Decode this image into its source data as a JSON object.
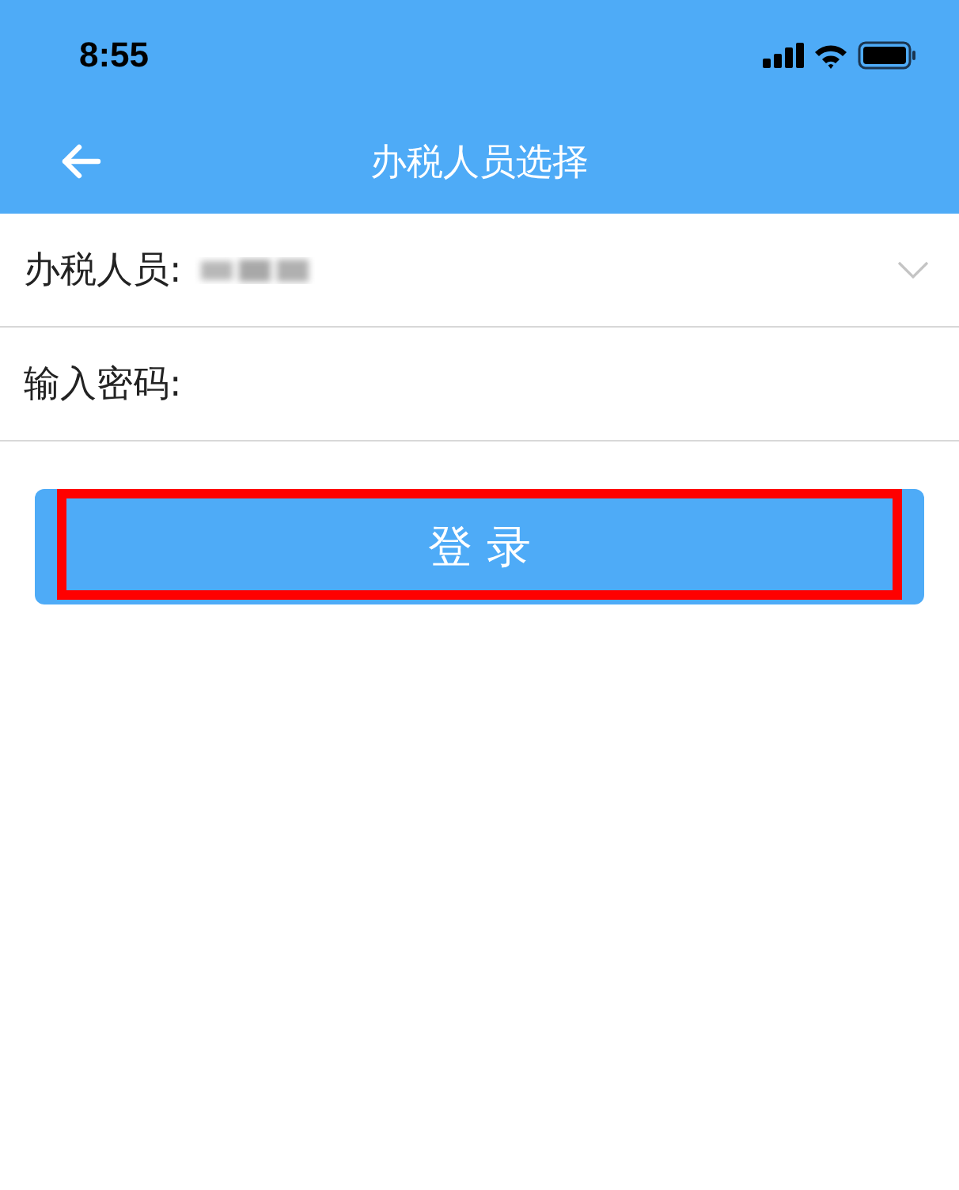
{
  "status_bar": {
    "time": "8:55"
  },
  "nav_bar": {
    "title": "办税人员选择"
  },
  "form": {
    "taxpayer": {
      "label": "办税人员:"
    },
    "password": {
      "label": "输入密码:"
    }
  },
  "login_button": {
    "label": "登 录",
    "highlighted": true
  }
}
